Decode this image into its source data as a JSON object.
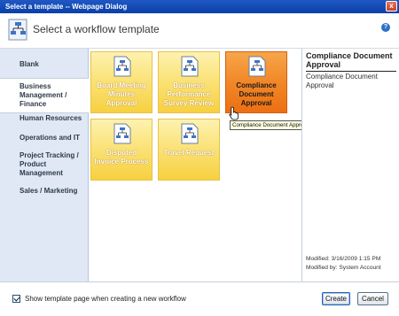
{
  "window": {
    "title": "Select a template -- Webpage Dialog",
    "close_glyph": "x"
  },
  "header": {
    "title": "Select a workflow template",
    "help_glyph": "?"
  },
  "sidebar": {
    "items": [
      {
        "label": "Blank"
      },
      {
        "label": "Business Management / Finance"
      },
      {
        "label": "Human Resources"
      },
      {
        "label": "Operations and IT"
      },
      {
        "label": "Project Tracking / Product Management"
      },
      {
        "label": "Sales / Marketing"
      }
    ],
    "active_index": 1
  },
  "templates": [
    {
      "label": "Board Meeting Minutes Approval"
    },
    {
      "label": "Business Performance Survey Review"
    },
    {
      "label": "Compliance Document Approval"
    },
    {
      "label": "Disputed Invoice Process"
    },
    {
      "label": "Travel Request"
    }
  ],
  "tooltip": {
    "text": "Compliance Document Approval"
  },
  "details": {
    "title": "Compliance Document Approval",
    "description": "Compliance Document Approval",
    "modified": "Modified: 3/16/2009 1:15 PM",
    "modified_by": "Modified by: System Account"
  },
  "footer": {
    "checkbox_label": "Show template page when creating a new workflow",
    "checkbox_checked": true,
    "create_label": "Create",
    "cancel_label": "Cancel"
  },
  "colors": {
    "titlebar": "#0a3fa8",
    "sidebar_bg": "#dfe8f4",
    "tile_gold": "#f7d040",
    "tile_selected": "#ec6f12"
  }
}
